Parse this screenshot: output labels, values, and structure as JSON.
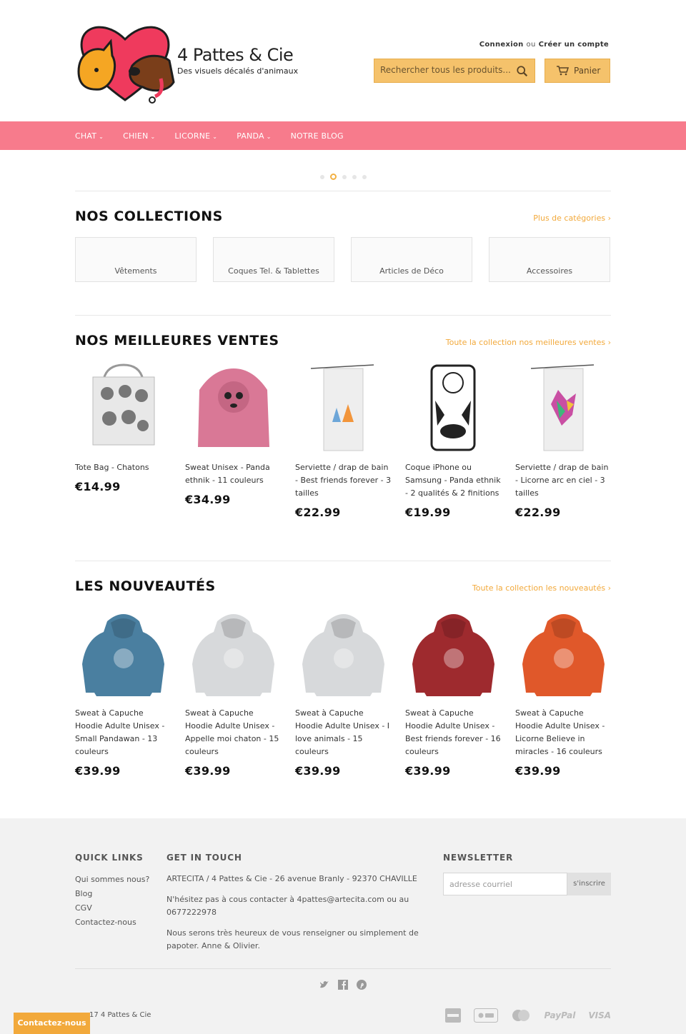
{
  "brand": {
    "name": "4 Pattes & Cie",
    "tagline": "Des visuels décalés d'animaux"
  },
  "header": {
    "login": "Connexion",
    "or": "ou",
    "register": "Créer un compte",
    "search_placeholder": "Rechercher tous les produits...",
    "cart_label": "Panier"
  },
  "nav": {
    "items": [
      {
        "label": "CHAT",
        "has_dropdown": true
      },
      {
        "label": "CHIEN",
        "has_dropdown": true
      },
      {
        "label": "LICORNE",
        "has_dropdown": true
      },
      {
        "label": "PANDA",
        "has_dropdown": true
      },
      {
        "label": "NOTRE BLOG",
        "has_dropdown": false
      }
    ]
  },
  "slider": {
    "dot_count": 5,
    "active_index": 1
  },
  "collections": {
    "title": "NOS COLLECTIONS",
    "link": "Plus de catégories ›",
    "items": [
      "Vêtements",
      "Coques Tel. & Tablettes",
      "Articles de Déco",
      "Accessoires"
    ]
  },
  "bestsellers": {
    "title": "NOS MEILLEURES VENTES",
    "link": "Toute la collection nos meilleures ventes ›",
    "items": [
      {
        "name": "Tote Bag - Chatons",
        "price": "€14.99"
      },
      {
        "name": "Sweat Unisex - Panda ethnik - 11 couleurs",
        "price": "€34.99"
      },
      {
        "name": "Serviette / drap de bain - Best friends forever - 3 tailles",
        "price": "€22.99"
      },
      {
        "name": "Coque iPhone ou Samsung - Panda ethnik - 2 qualités & 2 finitions",
        "price": "€19.99"
      },
      {
        "name": "Serviette / drap de bain - Licorne arc en ciel - 3 tailles",
        "price": "€22.99"
      }
    ]
  },
  "new_arrivals": {
    "title": "LES NOUVEAUTÉS",
    "link": "Toute la collection les nouveautés ›",
    "items": [
      {
        "name": "Sweat à Capuche Hoodie Adulte Unisex - Small Pandawan - 13 couleurs",
        "price": "€39.99",
        "color": "#4a7fa0"
      },
      {
        "name": "Sweat à Capuche Hoodie Adulte Unisex - Appelle moi chaton - 15 couleurs",
        "price": "€39.99",
        "color": "#d7d9db"
      },
      {
        "name": "Sweat à Capuche Hoodie Adulte Unisex - I love animals - 15 couleurs",
        "price": "€39.99",
        "color": "#d7d9db"
      },
      {
        "name": "Sweat à Capuche Hoodie Adulte Unisex - Best friends forever - 16 couleurs",
        "price": "€39.99",
        "color": "#9e2a2e"
      },
      {
        "name": "Sweat à Capuche Hoodie Adulte Unisex - Licorne Believe in miracles - 16 couleurs",
        "price": "€39.99",
        "color": "#e0582a"
      }
    ]
  },
  "footer": {
    "quick_links_title": "QUICK LINKS",
    "quick_links": [
      "Qui sommes nous?",
      "Blog",
      "CGV",
      "Contactez-nous"
    ],
    "contact_title": "GET IN TOUCH",
    "contact_lines": [
      "ARTECITA / 4 Pattes & Cie - 26 avenue Branly - 92370 CHAVILLE",
      "N'hésitez pas à cous contacter à 4pattes@artecita.com ou au 0677222978",
      "Nous serons très heureux de vous renseigner ou simplement de papoter. Anne & Olivier."
    ],
    "newsletter_title": "NEWSLETTER",
    "newsletter_placeholder": "adresse courriel",
    "newsletter_button": "s'inscrire",
    "copyright": "17 4 Pattes & Cie",
    "payments": [
      "American Express",
      "Apple Pay",
      "MasterCard",
      "PayPal",
      "VISA"
    ]
  },
  "contact_tab": "Contactez-nous",
  "colors": {
    "nav_bg": "#f77b8c",
    "accent": "#f2a93b",
    "button_bg": "#f5c26b",
    "footer_bg": "#f2f2f2"
  }
}
